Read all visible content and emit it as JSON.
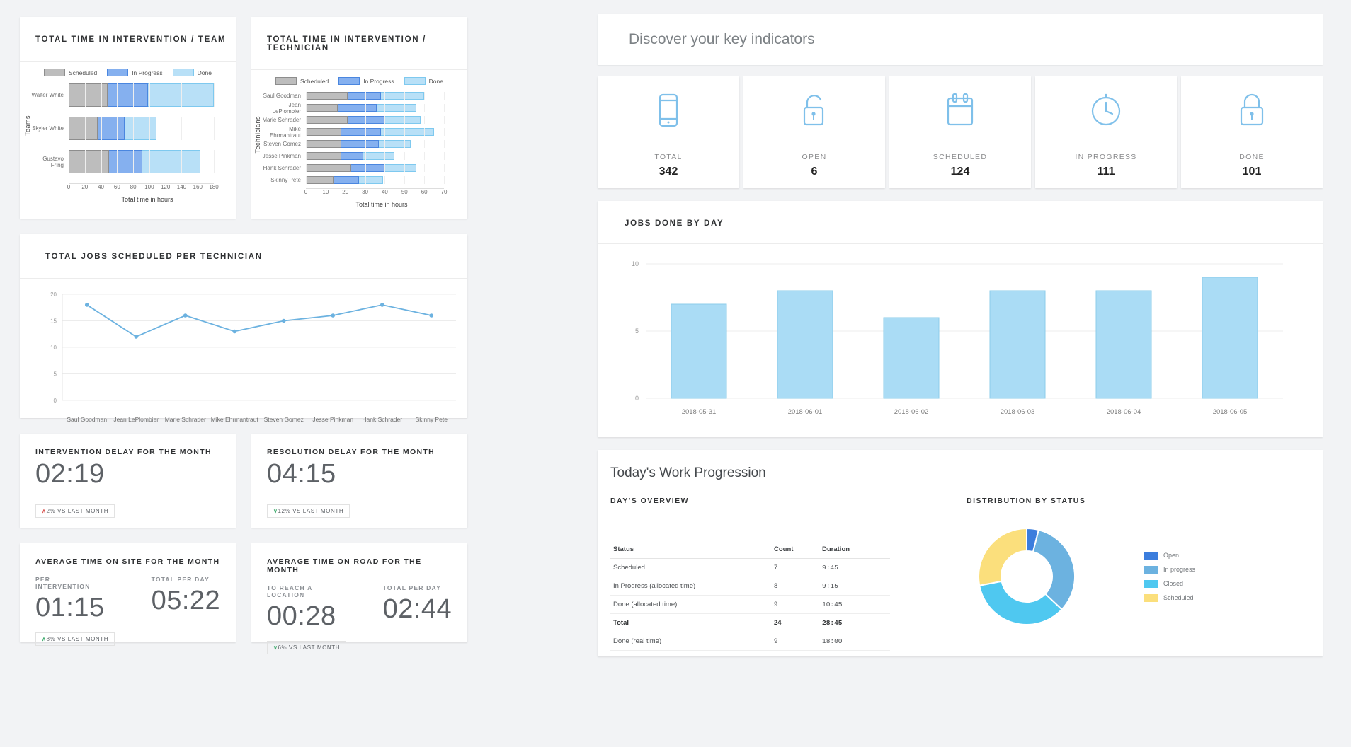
{
  "left": {
    "team_chart": {
      "title": "TOTAL TIME IN INTERVENTION / TEAM",
      "ylabel": "Teams",
      "xlabel": "Total time in hours"
    },
    "tech_chart": {
      "title": "TOTAL TIME IN INTERVENTION / TECHNICIAN",
      "ylabel": "Technicians",
      "xlabel": "Total time in hours"
    },
    "legend": [
      {
        "label": "Scheduled",
        "color": "#bdbdbd"
      },
      {
        "label": "In Progress",
        "color": "#85b0ef"
      },
      {
        "label": "Done",
        "color": "#b8e0f7"
      }
    ],
    "line_chart": {
      "title": "TOTAL JOBS SCHEDULED PER TECHNICIAN"
    },
    "kpis": [
      {
        "title": "INTERVENTION DELAY FOR THE MONTH",
        "value": "02:19",
        "delta_arrow": "∧",
        "delta_dir": "up-red",
        "delta_text": "2% VS LAST MONTH"
      },
      {
        "title": "RESOLUTION DELAY FOR THE MONTH",
        "value": "04:15",
        "delta_arrow": "∨",
        "delta_dir": "dn-green",
        "delta_text": "12% VS LAST MONTH"
      }
    ],
    "kpis2": [
      {
        "title": "AVERAGE TIME ON SITE FOR THE MONTH",
        "col1_label": "PER INTERVENTION",
        "col1_value": "01:15",
        "col2_label": "TOTAL PER DAY",
        "col2_value": "05:22",
        "delta_arrow": "∧",
        "delta_dir": "up-green",
        "delta_text": "8% VS LAST MONTH"
      },
      {
        "title": "AVERAGE TIME ON ROAD FOR THE MONTH",
        "col1_label": "TO REACH A LOCATION",
        "col1_value": "00:28",
        "col2_label": "TOTAL PER DAY",
        "col2_value": "02:44",
        "delta_arrow": "∨",
        "delta_dir": "dn-green",
        "delta_text": "6% VS LAST MONTH"
      }
    ]
  },
  "right": {
    "discover_title": "Discover your key indicators",
    "kpi_tiles": [
      {
        "icon": "mobile-icon",
        "label": "TOTAL",
        "value": "342"
      },
      {
        "icon": "unlock-icon",
        "label": "OPEN",
        "value": "6"
      },
      {
        "icon": "calendar-icon",
        "label": "SCHEDULED",
        "value": "124"
      },
      {
        "icon": "stopwatch-icon",
        "label": "IN PROGRESS",
        "value": "111"
      },
      {
        "icon": "lock-icon",
        "label": "DONE",
        "value": "101"
      }
    ],
    "jobs_title": "JOBS DONE BY DAY",
    "progression": {
      "title": "Today's Work Progression",
      "day_overview_label": "DAY'S OVERVIEW",
      "distribution_label": "DISTRIBUTION BY STATUS",
      "table": {
        "headers": [
          "Status",
          "Count",
          "Duration"
        ],
        "rows": [
          {
            "status": "Scheduled",
            "count": "7",
            "duration": "9:45",
            "total": false
          },
          {
            "status": "In Progress (allocated time)",
            "count": "8",
            "duration": "9:15",
            "total": false
          },
          {
            "status": "Done (allocated time)",
            "count": "9",
            "duration": "10:45",
            "total": false
          },
          {
            "status": "Total",
            "count": "24",
            "duration": "28:45",
            "total": true
          },
          {
            "status": "Done (real time)",
            "count": "9",
            "duration": "18:00",
            "total": false
          }
        ]
      }
    }
  },
  "chart_data": [
    {
      "type": "bar",
      "id": "total-time-by-team",
      "orientation": "horizontal",
      "stacked": true,
      "title": "TOTAL TIME IN INTERVENTION / TEAM",
      "xlabel": "Total time in hours",
      "ylabel": "Teams",
      "categories": [
        "Walter White",
        "Skyler White",
        "Gustavo Fring"
      ],
      "series": [
        {
          "name": "Scheduled",
          "color": "#bdbdbd",
          "values": [
            48,
            36,
            50
          ]
        },
        {
          "name": "In Progress",
          "color": "#85b0ef",
          "values": [
            50,
            33,
            41
          ]
        },
        {
          "name": "Done",
          "color": "#b8e0f7",
          "values": [
            82,
            40,
            72
          ]
        }
      ],
      "xticks": [
        0,
        20,
        40,
        60,
        80,
        100,
        120,
        140,
        160,
        180
      ],
      "xlim": [
        0,
        180
      ],
      "grid": true,
      "legend_position": "top"
    },
    {
      "type": "bar",
      "id": "total-time-by-technician",
      "orientation": "horizontal",
      "stacked": true,
      "title": "TOTAL TIME IN INTERVENTION / TECHNICIAN",
      "xlabel": "Total time in hours",
      "ylabel": "Technicians",
      "categories": [
        "Saul Goodman",
        "Jean LePlombier",
        "Marie Schrader",
        "Mike Ehrmantraut",
        "Steven Gomez",
        "Jesse Pinkman",
        "Hank Schrader",
        "Skinny Pete"
      ],
      "series": [
        {
          "name": "Scheduled",
          "color": "#bdbdbd",
          "values": [
            21,
            16,
            21,
            18,
            18,
            18,
            23,
            14
          ]
        },
        {
          "name": "In Progress",
          "color": "#85b0ef",
          "values": [
            17,
            20,
            19,
            20,
            19,
            11,
            17,
            13
          ]
        },
        {
          "name": "Done",
          "color": "#b8e0f7",
          "values": [
            22,
            20,
            18,
            27,
            16,
            16,
            16,
            12
          ]
        }
      ],
      "xticks": [
        0,
        10,
        20,
        30,
        40,
        50,
        60,
        70
      ],
      "xlim": [
        0,
        70
      ],
      "grid": true,
      "legend_position": "top"
    },
    {
      "type": "line",
      "id": "jobs-scheduled-per-technician",
      "title": "TOTAL JOBS SCHEDULED PER TECHNICIAN",
      "categories": [
        "Saul Goodman",
        "Jean LePlombier",
        "Marie Schrader",
        "Mike Ehrmantraut",
        "Steven Gomez",
        "Jesse Pinkman",
        "Hank Schrader",
        "Skinny Pete"
      ],
      "values": [
        18,
        12,
        16,
        13,
        15,
        16,
        18,
        16
      ],
      "color": "#6cb2e0",
      "yticks": [
        0,
        5,
        10,
        15,
        20
      ],
      "ylim": [
        0,
        20
      ],
      "grid": true,
      "xlabel": "",
      "ylabel": ""
    },
    {
      "type": "bar",
      "id": "jobs-done-by-day",
      "orientation": "vertical",
      "title": "JOBS DONE BY DAY",
      "categories": [
        "2018-05-31",
        "2018-06-01",
        "2018-06-02",
        "2018-06-03",
        "2018-06-04",
        "2018-06-05"
      ],
      "values": [
        7,
        8,
        6,
        8,
        8,
        9
      ],
      "color": "#aadcf5",
      "yticks": [
        0,
        5,
        10
      ],
      "ylim": [
        0,
        10
      ],
      "grid": true,
      "xlabel": "",
      "ylabel": ""
    },
    {
      "type": "pie",
      "id": "distribution-by-status",
      "title": "DISTRIBUTION BY STATUS",
      "donut": true,
      "labels": [
        "Open",
        "In progress",
        "Closed",
        "Scheduled"
      ],
      "values": [
        4,
        33,
        35,
        28
      ],
      "colors": [
        "#3b7ddd",
        "#6cb2e0",
        "#4fc8f0",
        "#fbdf7c"
      ],
      "legend_position": "right"
    }
  ]
}
